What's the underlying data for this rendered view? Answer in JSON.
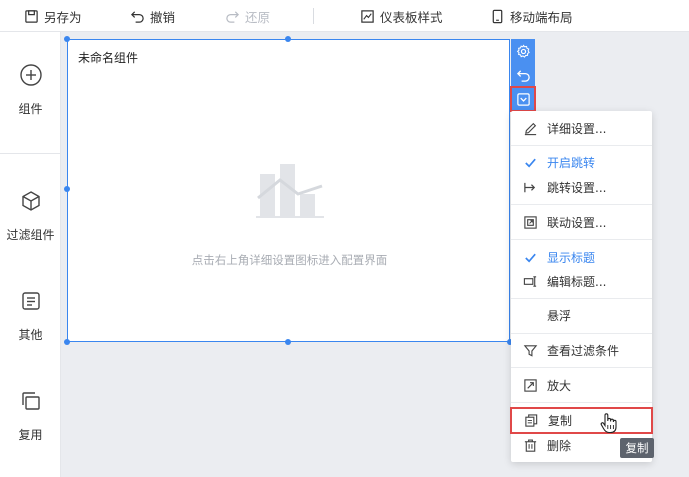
{
  "toolbar": {
    "save_as": "另存为",
    "undo": "撤销",
    "redo": "还原",
    "dashboard_style": "仪表板样式",
    "mobile_layout": "移动端布局"
  },
  "sidebar": {
    "items": [
      {
        "label": "组件"
      },
      {
        "label": "过滤组件"
      },
      {
        "label": "其他"
      },
      {
        "label": "复用"
      }
    ]
  },
  "widget": {
    "title": "未命名组件",
    "hint": "点击右上角详细设置图标进入配置界面"
  },
  "menu": {
    "items": [
      {
        "label": "详细设置..."
      },
      {
        "label": "开启跳转"
      },
      {
        "label": "跳转设置..."
      },
      {
        "label": "联动设置..."
      },
      {
        "label": "显示标题"
      },
      {
        "label": "编辑标题..."
      },
      {
        "label": "悬浮"
      },
      {
        "label": "查看过滤条件"
      },
      {
        "label": "放大"
      },
      {
        "label": "复制"
      },
      {
        "label": "删除"
      }
    ]
  },
  "tooltip": "复制",
  "colors": {
    "accent": "#3a86ef",
    "highlight": "#e04848",
    "canvas": "#ebedf1"
  }
}
